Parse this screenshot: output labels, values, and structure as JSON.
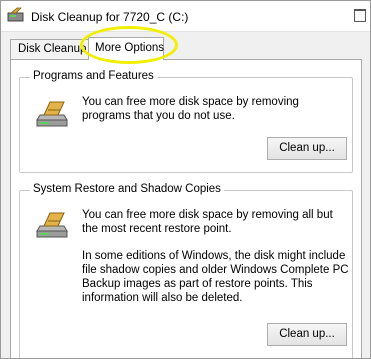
{
  "window": {
    "title": "Disk Cleanup for 7720_C (C:)",
    "title_icon": "disk-cleanup-icon"
  },
  "tabs": [
    {
      "label": "Disk Cleanup",
      "selected": false
    },
    {
      "label": "More Options",
      "selected": true
    }
  ],
  "annotation": {
    "highlight_color": "#f1ee00",
    "target": "More Options tab"
  },
  "groups": {
    "programs": {
      "title": "Programs and Features",
      "icon": "programs-features-icon",
      "text": "You can free more disk space by removing programs that you do not use.",
      "button": "Clean up..."
    },
    "restore": {
      "title": "System Restore and Shadow Copies",
      "icon": "system-restore-icon",
      "text": "You can free more disk space by removing all but the most recent restore point.",
      "text2": "In some editions of Windows, the disk might include file shadow copies and older Windows Complete PC Backup images as part of restore points. This information will also be deleted.",
      "button": "Clean up..."
    }
  }
}
